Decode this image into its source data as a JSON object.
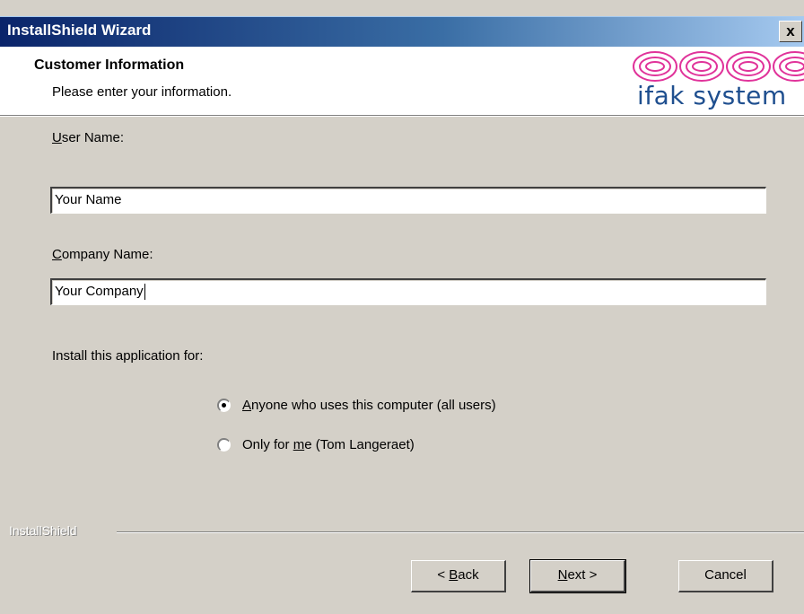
{
  "window": {
    "title": "InstallShield Wizard",
    "close_label": "x"
  },
  "header": {
    "title": "Customer Information",
    "subtitle": "Please enter your information.",
    "logo_text": "ifak system"
  },
  "form": {
    "user_name": {
      "label_accel": "U",
      "label_rest": "ser Name:",
      "value": "Your Name"
    },
    "company_name": {
      "label_accel": "C",
      "label_rest": "ompany Name:",
      "value": "Your Company"
    },
    "install_for": {
      "label": "Install this application for:",
      "options": [
        {
          "accel": "A",
          "rest": "nyone who uses this computer (all users)",
          "selected": true
        },
        {
          "pre": "Only for ",
          "accel": "m",
          "rest": "e (Tom Langeraet)",
          "selected": false
        }
      ]
    }
  },
  "footer": {
    "brand": "InstallShield",
    "back": {
      "pre": "< ",
      "accel": "B",
      "rest": "ack"
    },
    "next": {
      "accel": "N",
      "rest": "ext >"
    },
    "cancel": "Cancel"
  },
  "colors": {
    "titlebar_start": "#0a246a",
    "titlebar_end": "#a6caf0",
    "dialog_bg": "#d4d0c8",
    "logo_blue": "#1f4f8f",
    "logo_pink": "#e0339a"
  },
  "icons": [
    "close-icon",
    "ifak-logo"
  ]
}
